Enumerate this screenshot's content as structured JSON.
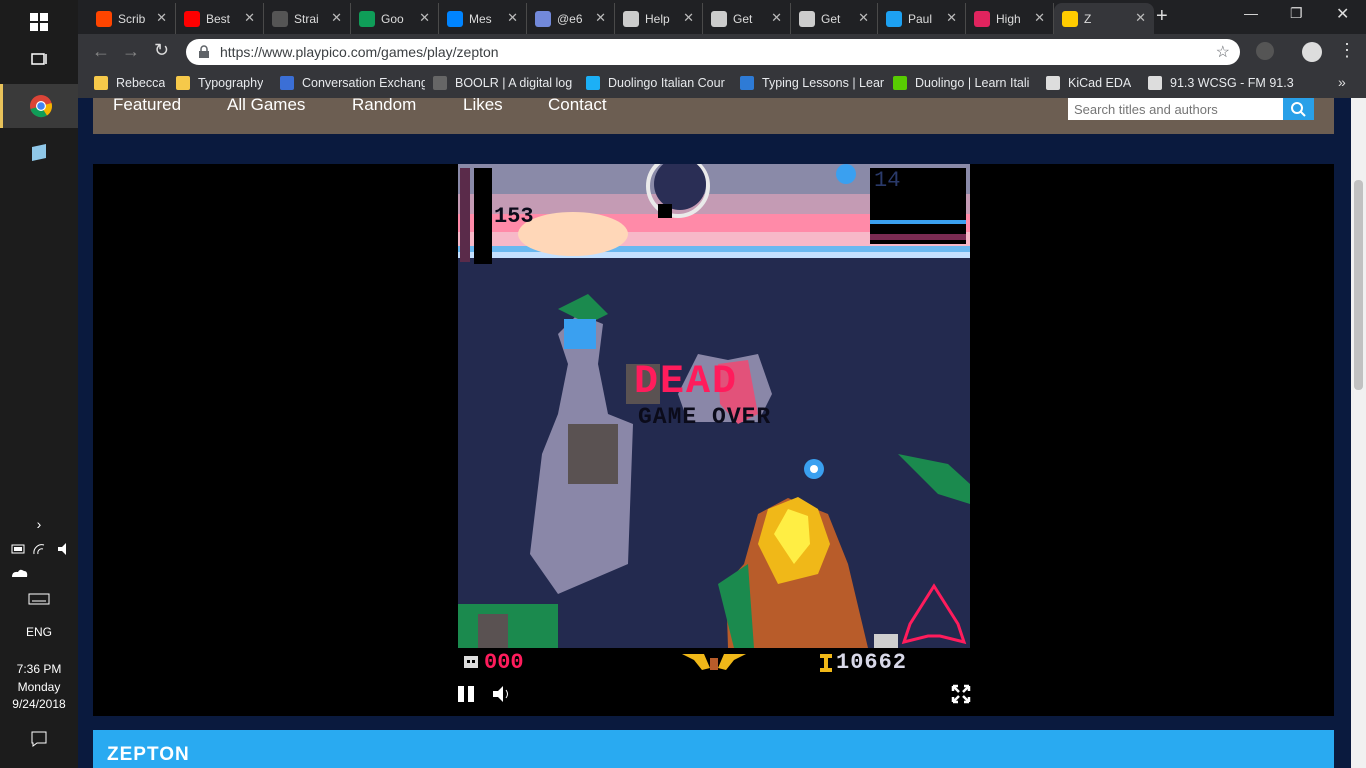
{
  "taskbar": {
    "time": "7:36 PM",
    "day": "Monday",
    "date": "9/24/2018",
    "language": "ENG"
  },
  "tabs": [
    {
      "title": "Scrib",
      "icon": "reddit-icon",
      "color": "#ff4500"
    },
    {
      "title": "Best",
      "icon": "youtube-icon",
      "color": "#ff0000"
    },
    {
      "title": "Strai",
      "icon": "pt-icon",
      "color": "#555555"
    },
    {
      "title": "Goo",
      "icon": "hangouts-icon",
      "color": "#0f9d58"
    },
    {
      "title": "Mes",
      "icon": "messenger-icon",
      "color": "#0084ff"
    },
    {
      "title": "@e6",
      "icon": "discord-icon",
      "color": "#7289da"
    },
    {
      "title": "Help",
      "icon": "page-icon",
      "color": "#cccccc"
    },
    {
      "title": "Get",
      "icon": "page-icon",
      "color": "#cccccc"
    },
    {
      "title": "Get",
      "icon": "page-icon",
      "color": "#cccccc"
    },
    {
      "title": "Paul",
      "icon": "twitter-icon",
      "color": "#1da1f2"
    },
    {
      "title": "High",
      "icon": "hi-icon",
      "color": "#e0245e"
    },
    {
      "title": "Z",
      "icon": "pico-icon",
      "color": "#ffcc00"
    }
  ],
  "address": {
    "url": "https://www.playpico.com/games/play/zepton"
  },
  "bookmarks": [
    {
      "label": "Rebecca",
      "icon": "folder-icon"
    },
    {
      "label": "Typography",
      "icon": "folder-icon"
    },
    {
      "label": "Conversation Exchang",
      "icon": "e-icon"
    },
    {
      "label": "BOOLR | A digital log",
      "icon": "chip-icon"
    },
    {
      "label": "Duolingo Italian Cour",
      "icon": "d-icon"
    },
    {
      "label": "Typing Lessons | Lear",
      "icon": "t-icon"
    },
    {
      "label": "Duolingo | Learn Itali",
      "icon": "owl-icon"
    },
    {
      "label": "KiCad EDA",
      "icon": "k-icon"
    },
    {
      "label": "91.3 WCSG - FM 91.3",
      "icon": "page-icon"
    }
  ],
  "site_nav": {
    "items": [
      "Featured",
      "All Games",
      "Random",
      "Likes",
      "Contact"
    ],
    "search_placeholder": "Search titles and authors"
  },
  "game": {
    "altitude": "153",
    "fuel": "14",
    "status": "DEAD",
    "game_over": "GAME OVER",
    "lives": "000",
    "score": "10662"
  },
  "page_title": "ZEPTON"
}
